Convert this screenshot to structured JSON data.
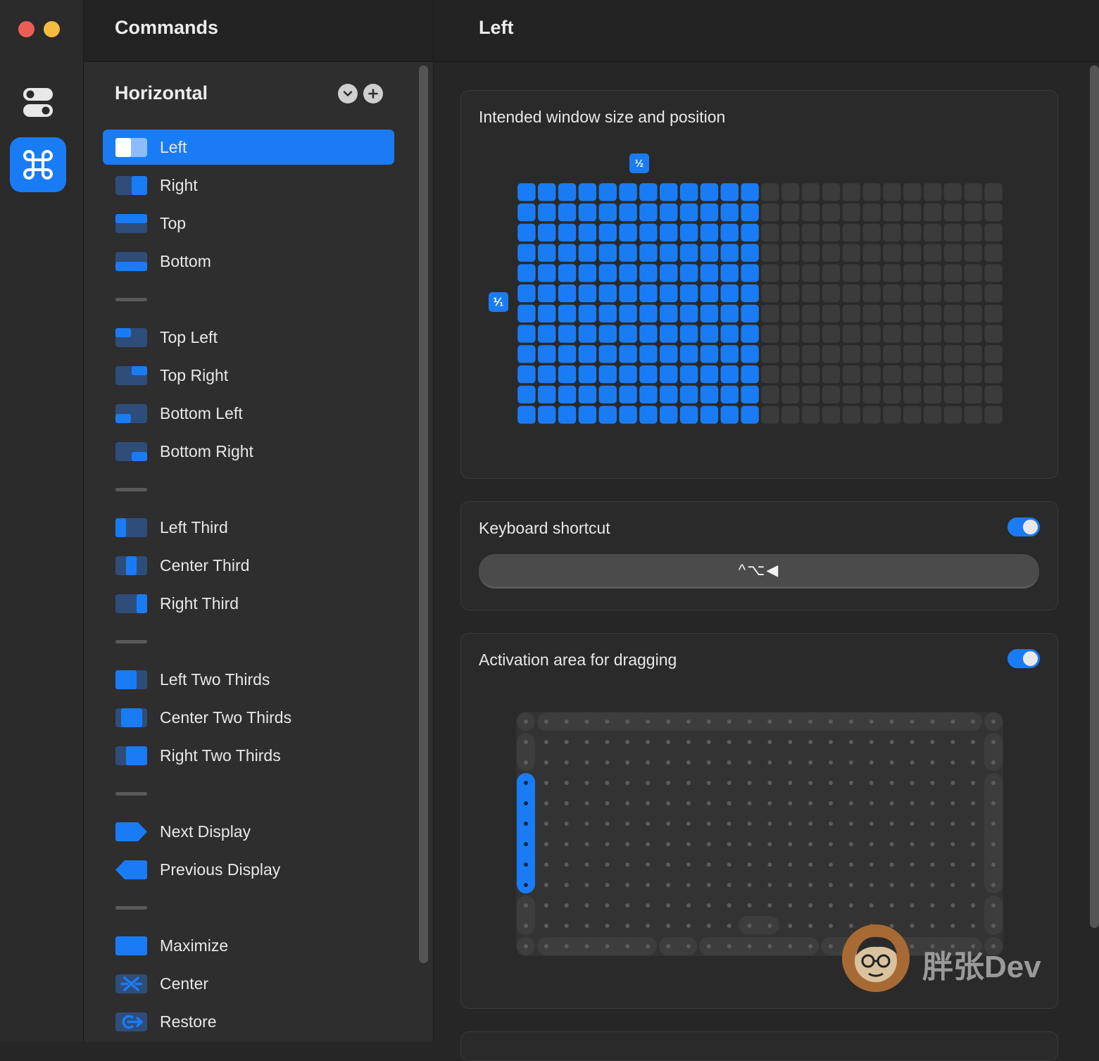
{
  "colors": {
    "accent": "#1a7cf5",
    "inactive_cell": "#3b3b3b",
    "close": "#ec5d55",
    "minimize": "#f4bd3d"
  },
  "rail": {
    "items": [
      {
        "name": "general",
        "icon": "toggles-icon"
      },
      {
        "name": "commands",
        "icon": "command-icon",
        "selected": true
      }
    ]
  },
  "sidebar": {
    "title": "Commands",
    "group": {
      "title": "Horizontal"
    },
    "items": [
      {
        "label": "Left",
        "icon": "left",
        "selected": true
      },
      {
        "label": "Right",
        "icon": "right"
      },
      {
        "label": "Top",
        "icon": "top"
      },
      {
        "label": "Bottom",
        "icon": "bottom"
      },
      {
        "separator": true
      },
      {
        "label": "Top Left",
        "icon": "top-left"
      },
      {
        "label": "Top Right",
        "icon": "top-right"
      },
      {
        "label": "Bottom Left",
        "icon": "bottom-left"
      },
      {
        "label": "Bottom Right",
        "icon": "bottom-right"
      },
      {
        "separator": true
      },
      {
        "label": "Left Third",
        "icon": "left-third"
      },
      {
        "label": "Center Third",
        "icon": "center-third"
      },
      {
        "label": "Right Third",
        "icon": "right-third"
      },
      {
        "separator": true
      },
      {
        "label": "Left Two Thirds",
        "icon": "left-two-thirds"
      },
      {
        "label": "Center Two Thirds",
        "icon": "center-two-thirds"
      },
      {
        "label": "Right Two Thirds",
        "icon": "right-two-thirds"
      },
      {
        "separator": true
      },
      {
        "label": "Next Display",
        "icon": "next-display"
      },
      {
        "label": "Previous Display",
        "icon": "previous-display"
      },
      {
        "separator": true
      },
      {
        "label": "Maximize",
        "icon": "maximize"
      },
      {
        "label": "Center",
        "icon": "center"
      },
      {
        "label": "Restore",
        "icon": "restore"
      }
    ]
  },
  "main": {
    "title": "Left",
    "size_card": {
      "title": "Intended window size and position",
      "width_fraction_label": "½",
      "height_fraction_label": "⅟₁",
      "grid": {
        "columns": 24,
        "rows": 12,
        "active_columns": 12,
        "active_rows": 12
      }
    },
    "shortcut_card": {
      "title": "Keyboard shortcut",
      "enabled": true,
      "shortcut": "^⌥◀"
    },
    "drag_card": {
      "title": "Activation area for dragging",
      "enabled": true,
      "active_edge": "left"
    }
  },
  "watermark": {
    "text": "胖张Dev"
  }
}
